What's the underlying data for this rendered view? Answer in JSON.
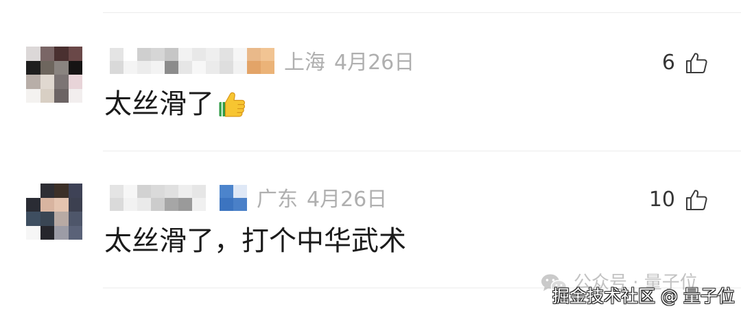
{
  "comments": [
    {
      "avatar_mosaic": [
        "#dcd8d8",
        "#7a6666",
        "#4a3030",
        "#6a4848",
        "#1e1e1e",
        "#6e665e",
        "#8a8480",
        "#161414",
        "#b8aea8",
        "#e0d8d0",
        "#7c7474",
        "#e8d4d8",
        "#f4f2f0",
        "#d8cfc4",
        "#6c6464",
        "#f2eeee"
      ],
      "name_mosaic": [
        "#e4e4e4",
        "#ffffff",
        "#cfcfcf",
        "#d6d6d6",
        "#c6c6c6",
        "#f2f2f2",
        "#e8e8e8",
        "#efefef",
        "#e2e2e2",
        "#f6f6f6",
        "#e9b98a",
        "#f1c493",
        "#d9d9d9",
        "#f4f4f4",
        "#ececec",
        "#f3f3f3",
        "#8c8c8c",
        "#e6e6e6",
        "#f7f7f7",
        "#ebebeb",
        "#dedede",
        "#f2f2f2",
        "#e3a468",
        "#ebb378"
      ],
      "location": "上海",
      "date": "4月26日",
      "likes": 6,
      "text": "太丝滑了",
      "emoji": "thumbs-up-emoji",
      "like_icon": "thumbs-up-outline"
    },
    {
      "avatar_mosaic": [
        "#ffffff",
        "#2e2e34",
        "#3c3028",
        "#3e4256",
        "#2a2c34",
        "#d8b4a0",
        "#e4c4b0",
        "#3c4050",
        "#3e4e60",
        "#3a4654",
        "#b8aaa4",
        "#4e566a",
        "#f6f6f6",
        "#26262c",
        "#9c9ca6",
        "#5a6278"
      ],
      "name_mosaic": [
        "#e4e4e4",
        "#f6f6f6",
        "#d2d2d2",
        "#dadada",
        "#e0e0e0",
        "#eeeeee",
        "#e6e6e6",
        "#ffffff",
        "#4c84cc",
        "#dfe8f6",
        "#dadada",
        "#f2f2f2",
        "#eaeaea",
        "#cccccc",
        "#a6a6a6",
        "#9a9a9a",
        "#f0f0f0",
        "#ffffff",
        "#3c74c0",
        "#4a80c8"
      ],
      "location": "广东",
      "date": "4月26日",
      "likes": 10,
      "text": "太丝滑了，打个中华武术",
      "like_icon": "thumbs-up-outline"
    }
  ],
  "watermark": {
    "icon": "wechat-icon",
    "account": "公众号 · 量子位",
    "credit": "掘金技术社区 @ 量子位"
  },
  "colors": {
    "text": "#1b1b1b",
    "meta": "#afafaf",
    "like": "#353535",
    "divider": "#ebebeb",
    "watermark": "#9a9a9a",
    "credit": "#ffffff",
    "emoji_yellow": "#f7c531",
    "emoji_green": "#2e9a46"
  }
}
